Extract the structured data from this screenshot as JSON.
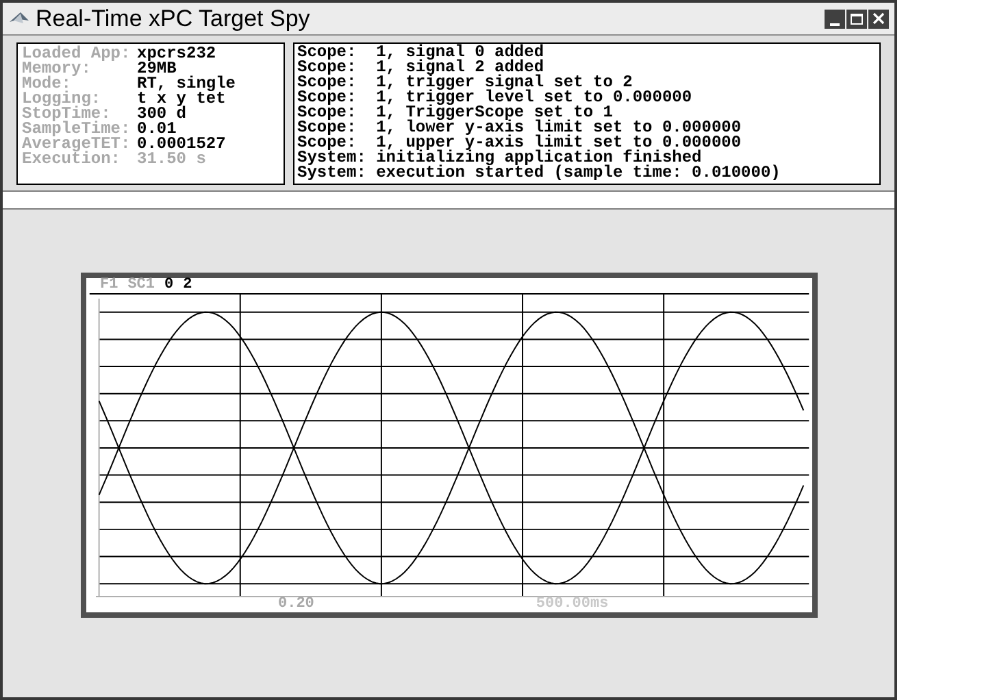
{
  "window": {
    "title": "Real-Time xPC Target Spy"
  },
  "info": [
    {
      "label": "Loaded App:",
      "value": "xpcrs232",
      "dimmed": false
    },
    {
      "label": "Memory:",
      "value": "29MB",
      "dimmed": false
    },
    {
      "label": "Mode:",
      "value": "RT, single",
      "dimmed": false
    },
    {
      "label": "Logging:",
      "value": "t x y tet",
      "dimmed": false
    },
    {
      "label": "StopTime:",
      "value": "300 d",
      "dimmed": false
    },
    {
      "label": "SampleTime:",
      "value": "0.01",
      "dimmed": false
    },
    {
      "label": "AverageTET:",
      "value": "0.0001527",
      "dimmed": false
    },
    {
      "label": "Execution:",
      "value": "31.50 s",
      "dimmed": true
    }
  ],
  "log": [
    "Scope:  1, signal 0 added",
    "Scope:  1, signal 2 added",
    "Scope:  1, trigger signal set to 2",
    "Scope:  1, trigger level set to 0.000000",
    "Scope:  1, TriggerScope set to 1",
    "Scope:  1, lower y-axis limit set to 0.000000",
    "Scope:  1, upper y-axis limit set to 0.000000",
    "System: initializing application finished",
    "System: execution started (sample time: 0.010000)"
  ],
  "scope": {
    "header": [
      {
        "text": "F1",
        "dimmed": true
      },
      {
        "text": "SC1",
        "dimmed": true
      },
      {
        "text": "0",
        "dimmed": false
      },
      {
        "text": "2",
        "dimmed": false
      }
    ],
    "tick_label": "0.20",
    "time_span": "500.00ms"
  }
}
